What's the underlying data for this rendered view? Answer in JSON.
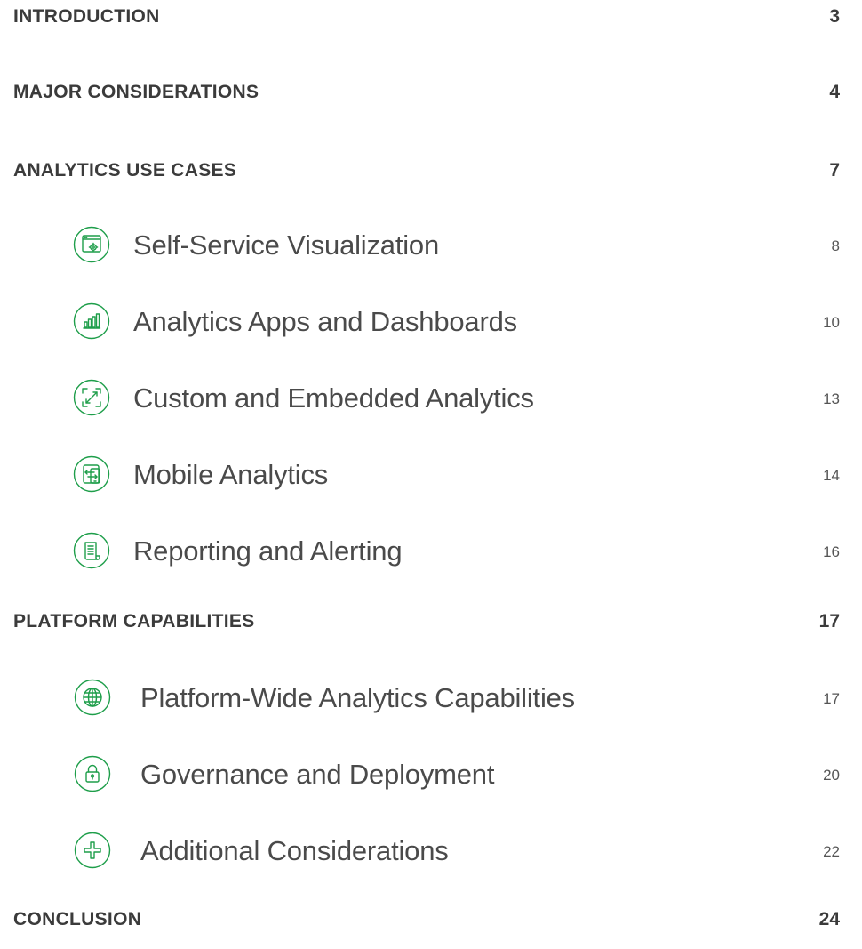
{
  "accent_color": "#1e9e4a",
  "toc": {
    "introduction": {
      "label": "INTRODUCTION",
      "page": "3"
    },
    "major_considerations": {
      "label": "MAJOR CONSIDERATIONS",
      "page": "4"
    },
    "analytics_use_cases": {
      "label": "ANALYTICS USE CASES",
      "page": "7",
      "items": [
        {
          "label": "Self-Service Visualization",
          "page": "8",
          "icon": "browser-gear-icon"
        },
        {
          "label": "Analytics Apps and Dashboards",
          "page": "10",
          "icon": "bar-chart-icon"
        },
        {
          "label": "Custom and Embedded Analytics",
          "page": "13",
          "icon": "expand-arrows-icon"
        },
        {
          "label": "Mobile Analytics",
          "page": "14",
          "icon": "mobile-devices-icon"
        },
        {
          "label": "Reporting and Alerting",
          "page": "16",
          "icon": "document-scroll-icon"
        }
      ]
    },
    "platform_capabilities": {
      "label": "PLATFORM CAPABILITIES",
      "page": "17",
      "items": [
        {
          "label": "Platform-Wide Analytics Capabilities",
          "page": "17",
          "icon": "globe-icon"
        },
        {
          "label": "Governance and Deployment",
          "page": "20",
          "icon": "lock-icon"
        },
        {
          "label": "Additional Considerations",
          "page": "22",
          "icon": "plus-icon"
        }
      ]
    },
    "conclusion": {
      "label": "CONCLUSION",
      "page": "24"
    }
  }
}
